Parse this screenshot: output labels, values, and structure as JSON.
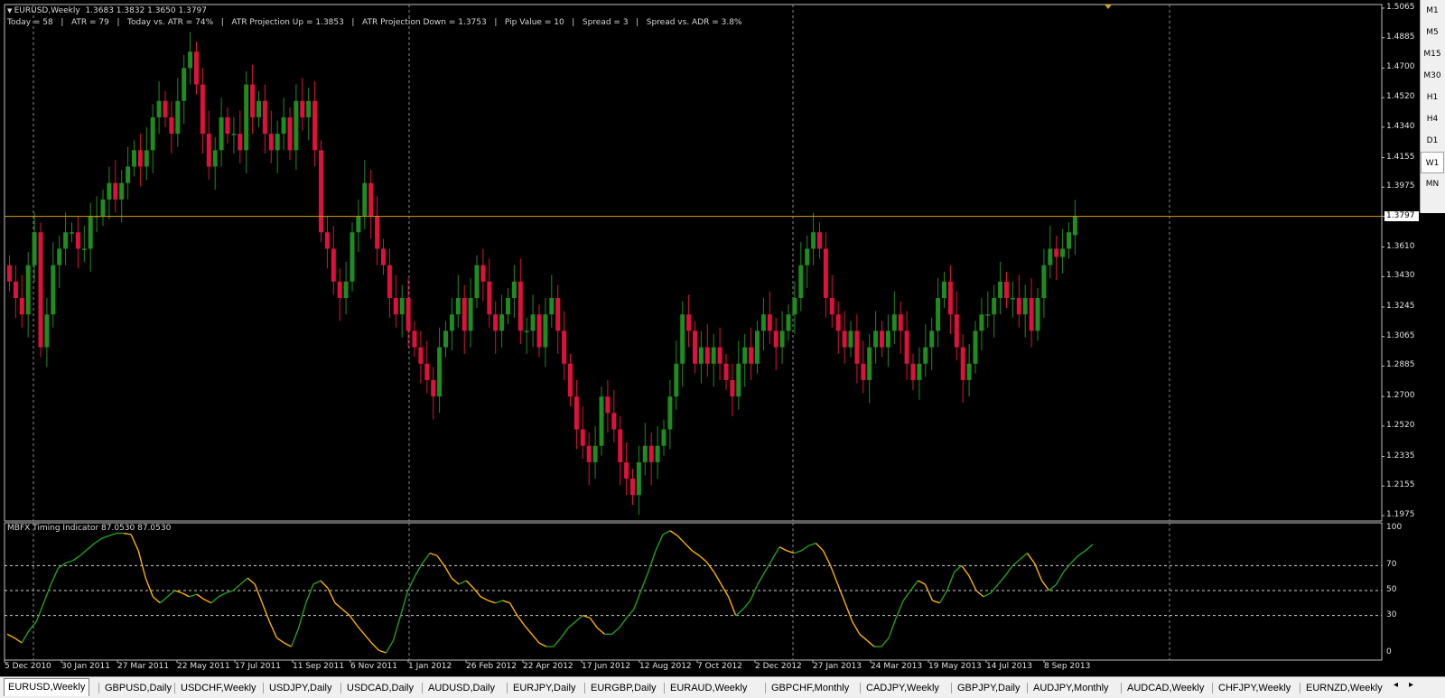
{
  "window": {
    "title": "EURUSD,Weekly",
    "ohlc": "1.3683 1.3832 1.3650 1.3797",
    "info_bar": "Today = 58   |   ATR = 79   |   Today vs. ATR = 74%   |   ATR Projection Up = 1.3853   |   ATR Projection Down = 1.3753   |   Pip Value = 10   |   Spread = 3   |   Spread vs. ADR = 3.8%"
  },
  "price_axis": {
    "labels": [
      "1.5065",
      "1.4885",
      "1.4700",
      "1.4520",
      "1.4340",
      "1.4155",
      "1.3975",
      "1.3797",
      "1.3610",
      "1.3430",
      "1.3245",
      "1.3065",
      "1.2885",
      "1.2700",
      "1.2520",
      "1.2335",
      "1.2155",
      "1.1975"
    ],
    "current_price": "1.3797"
  },
  "indicator": {
    "label": "MBFX Timing Indicator 87.0530 87.0530",
    "levels": [
      "100",
      "70",
      "50",
      "30",
      "0"
    ]
  },
  "date_axis": {
    "labels": [
      "5 Dec 2010",
      "30 Jan 2011",
      "27 Mar 2011",
      "22 May 2011",
      "17 Jul 2011",
      "11 Sep 2011",
      "6 Nov 2011",
      "1 Jan 2012",
      "26 Feb 2012",
      "22 Apr 2012",
      "17 Jun 2012",
      "12 Aug 2012",
      "7 Oct 2012",
      "2 Dec 2012",
      "27 Jan 2013",
      "24 Mar 2013",
      "19 May 2013",
      "14 Jul 2013",
      "8 Sep 2013"
    ]
  },
  "timeframes": {
    "items": [
      "M1",
      "M5",
      "M15",
      "M30",
      "H1",
      "H4",
      "D1",
      "W1",
      "MN"
    ],
    "active": "W1"
  },
  "tabs": {
    "items": [
      "EURUSD,Weekly",
      "GBPUSD,Daily",
      "USDCHF,Weekly",
      "USDJPY,Daily",
      "USDCAD,Daily",
      "AUDUSD,Daily",
      "EURJPY,Daily",
      "EURGBP,Daily",
      "EURAUD,Weekly",
      "GBPCHF,Monthly",
      "CADJPY,Weekly",
      "GBPJPY,Daily",
      "AUDJPY,Monthly",
      "AUDCAD,Weekly",
      "CHFJPY,Weekly",
      "EURNZD,Weekly"
    ],
    "active": "EURUSD,Weekly",
    "prev_arrow": "◂",
    "next_arrow": "▸"
  },
  "colors": {
    "background": "#000000",
    "bull": "#1e8c1e",
    "bear": "#e0103c",
    "price_line": "#d4a017",
    "ind_up": "#1fa01f",
    "ind_down": "#ffb000",
    "grid": "#8a8a8a"
  },
  "chart_data": {
    "type": "candlestick",
    "symbol": "EURUSD",
    "timeframe": "Weekly",
    "ylim": [
      1.1975,
      1.5065
    ],
    "close_series": [
      1.34,
      1.33,
      1.32,
      1.35,
      1.37,
      1.3,
      1.32,
      1.35,
      1.36,
      1.37,
      1.37,
      1.36,
      1.36,
      1.38,
      1.38,
      1.39,
      1.4,
      1.39,
      1.4,
      1.41,
      1.42,
      1.41,
      1.42,
      1.44,
      1.45,
      1.44,
      1.43,
      1.45,
      1.47,
      1.48,
      1.46,
      1.43,
      1.41,
      1.42,
      1.44,
      1.43,
      1.43,
      1.42,
      1.46,
      1.44,
      1.45,
      1.43,
      1.42,
      1.43,
      1.44,
      1.42,
      1.45,
      1.44,
      1.45,
      1.42,
      1.37,
      1.36,
      1.34,
      1.33,
      1.34,
      1.37,
      1.38,
      1.4,
      1.38,
      1.36,
      1.35,
      1.33,
      1.32,
      1.33,
      1.31,
      1.3,
      1.29,
      1.28,
      1.27,
      1.3,
      1.31,
      1.32,
      1.33,
      1.31,
      1.33,
      1.35,
      1.34,
      1.32,
      1.31,
      1.32,
      1.33,
      1.34,
      1.31,
      1.31,
      1.32,
      1.3,
      1.32,
      1.33,
      1.31,
      1.29,
      1.27,
      1.25,
      1.24,
      1.23,
      1.24,
      1.27,
      1.26,
      1.25,
      1.23,
      1.22,
      1.21,
      1.23,
      1.24,
      1.23,
      1.24,
      1.25,
      1.27,
      1.29,
      1.32,
      1.31,
      1.29,
      1.3,
      1.29,
      1.3,
      1.29,
      1.28,
      1.27,
      1.29,
      1.3,
      1.29,
      1.31,
      1.32,
      1.31,
      1.3,
      1.31,
      1.32,
      1.33,
      1.35,
      1.36,
      1.37,
      1.36,
      1.33,
      1.32,
      1.31,
      1.3,
      1.31,
      1.29,
      1.28,
      1.3,
      1.31,
      1.3,
      1.31,
      1.32,
      1.31,
      1.29,
      1.28,
      1.29,
      1.3,
      1.31,
      1.33,
      1.34,
      1.32,
      1.3,
      1.28,
      1.29,
      1.31,
      1.32,
      1.32,
      1.33,
      1.34,
      1.33,
      1.33,
      1.32,
      1.33,
      1.31,
      1.33,
      1.35,
      1.36,
      1.355,
      1.36,
      1.37,
      1.3797
    ],
    "indicator_series": [
      15,
      12,
      8,
      18,
      25,
      40,
      55,
      68,
      72,
      74,
      78,
      83,
      88,
      92,
      94,
      96,
      96,
      95,
      82,
      60,
      45,
      40,
      45,
      50,
      48,
      45,
      47,
      43,
      40,
      45,
      48,
      50,
      55,
      60,
      55,
      40,
      25,
      12,
      8,
      5,
      20,
      40,
      55,
      58,
      52,
      40,
      35,
      30,
      22,
      15,
      8,
      2,
      0,
      10,
      30,
      50,
      62,
      72,
      80,
      78,
      70,
      60,
      55,
      58,
      52,
      45,
      42,
      40,
      42,
      40,
      30,
      22,
      15,
      8,
      5,
      5,
      12,
      20,
      25,
      30,
      28,
      20,
      15,
      15,
      20,
      28,
      35,
      50,
      65,
      82,
      95,
      98,
      94,
      88,
      82,
      78,
      73,
      65,
      55,
      45,
      30,
      35,
      42,
      55,
      65,
      75,
      85,
      82,
      80,
      82,
      86,
      88,
      82,
      70,
      55,
      40,
      25,
      15,
      10,
      5,
      5,
      12,
      28,
      42,
      50,
      58,
      55,
      42,
      40,
      50,
      65,
      70,
      62,
      50,
      45,
      48,
      55,
      62,
      70,
      75,
      80,
      72,
      58,
      50,
      55,
      65,
      72,
      78,
      82,
      87.053
    ]
  }
}
